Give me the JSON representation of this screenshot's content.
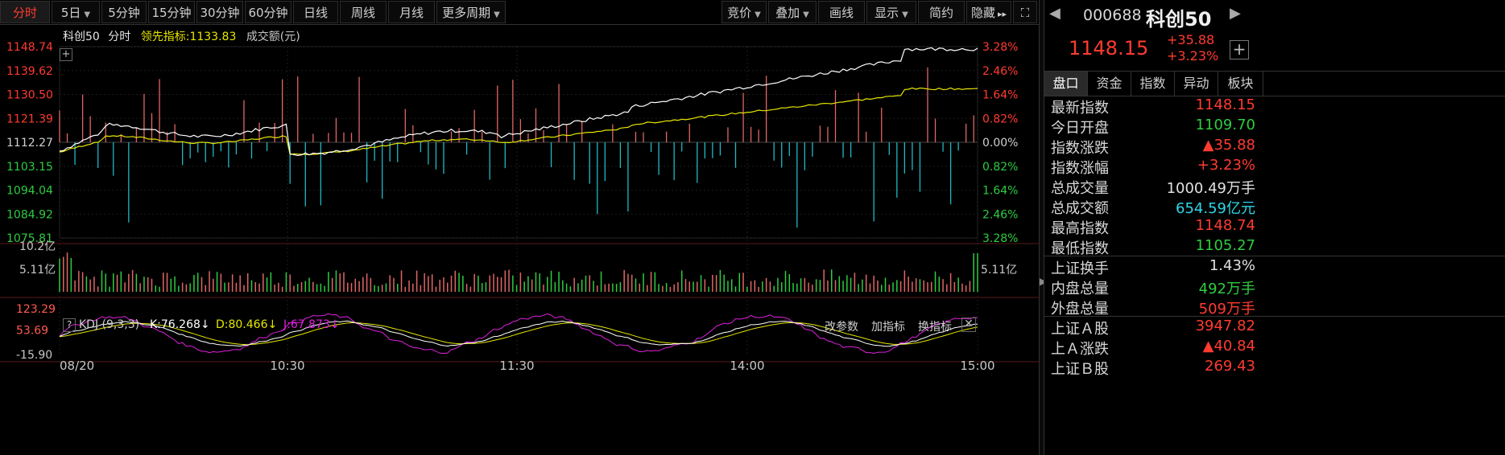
{
  "toolbar": {
    "tabs": [
      "分时",
      "5日",
      "5分钟",
      "15分钟",
      "30分钟",
      "60分钟",
      "日线",
      "周线",
      "月线",
      "更多周期"
    ],
    "right_tools": [
      "竞价",
      "叠加",
      "画线",
      "显示",
      "简约",
      "隐藏"
    ],
    "active_tab": "分时"
  },
  "legend": {
    "name": "科创50",
    "mode": "分时",
    "leading_label": "领先指标:",
    "leading_value": "1133.83",
    "turnover_label": "成交额(元)"
  },
  "price_axis": {
    "left_ticks": [
      "1148.74",
      "1139.62",
      "1130.50",
      "1121.39",
      "1112.27",
      "1103.15",
      "1094.04",
      "1084.92",
      "1075.81"
    ],
    "right_ticks": [
      "3.28%",
      "2.46%",
      "1.64%",
      "0.82%",
      "0.00%",
      "0.82%",
      "1.64%",
      "2.46%",
      "3.28%"
    ]
  },
  "volume_axis": {
    "ticks": [
      "10.2亿",
      "5.11亿"
    ]
  },
  "kdj": {
    "help": "?",
    "title": "KDJ (9,3,3)",
    "k_label": "K:76.268↓",
    "d_label": "D:80.466↓",
    "j_label": "J:67.873↓",
    "buttons": [
      "改参数",
      "加指标",
      "换指标"
    ],
    "ticks": [
      "123.29",
      "53.69",
      "-15.90"
    ]
  },
  "time_axis": [
    "08/20",
    "10:30",
    "11:30",
    "14:00",
    "15:00"
  ],
  "colors": {
    "up": "#ff3b30",
    "down": "#2ecc40",
    "price_line": "#ffffff",
    "leading_line": "#e6e600",
    "vol_up_bar": "#e06666",
    "vol_down_bar": "#21b8c4",
    "kdj_k": "#ffffff",
    "kdj_d": "#e6e600",
    "kdj_j": "#e020e0"
  },
  "quote": {
    "code": "000688",
    "name": "科创50",
    "price": "1148.15",
    "change": "+35.88",
    "change_pct": "+3.23%"
  },
  "panel_tabs": [
    "盘口",
    "资金",
    "指数",
    "异动",
    "板块"
  ],
  "stats": [
    {
      "label": "最新指数",
      "value": "1148.15",
      "color": "#ff3b30"
    },
    {
      "label": "今日开盘",
      "value": "1109.70",
      "color": "#2ecc40"
    },
    {
      "label": "指数涨跌",
      "value": "▲35.88",
      "color": "#ff3b30"
    },
    {
      "label": "指数涨幅",
      "value": "+3.23%",
      "color": "#ff3b30"
    },
    {
      "label": "总成交量",
      "value": "1000.49万手",
      "color": "#e0e0e0"
    },
    {
      "label": "总成交额",
      "value": "654.59亿元",
      "color": "#2fd6e6"
    },
    {
      "label": "最高指数",
      "value": "1148.74",
      "color": "#ff3b30"
    },
    {
      "label": "最低指数",
      "value": "1105.27",
      "color": "#2ecc40"
    }
  ],
  "stats2": [
    {
      "label": "上证换手",
      "value": "1.43%",
      "color": "#e0e0e0"
    },
    {
      "label": "内盘总量",
      "value": "492万手",
      "color": "#2ecc40"
    },
    {
      "label": "外盘总量",
      "value": "509万手",
      "color": "#ff3b30"
    }
  ],
  "stats3": [
    {
      "label": "上证Ａ股",
      "value": "3947.82",
      "color": "#ff3b30"
    },
    {
      "label": "上Ａ涨跌",
      "value": "▲40.84",
      "color": "#ff3b30"
    },
    {
      "label": "上证Ｂ股",
      "value": "269.43",
      "color": "#ff3b30"
    }
  ]
}
